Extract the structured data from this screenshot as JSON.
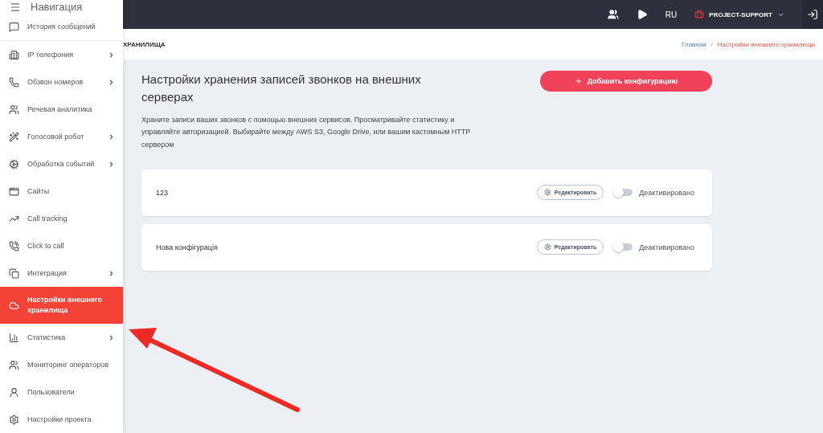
{
  "sidebar": {
    "title": "Навигация",
    "items": [
      {
        "label": "История сообщений",
        "expandable": false,
        "selected": false
      },
      {
        "label": "IP телефония",
        "expandable": true,
        "selected": false
      },
      {
        "label": "Обзвон номеров",
        "expandable": true,
        "selected": false
      },
      {
        "label": "Речевая аналитика",
        "expandable": false,
        "selected": false
      },
      {
        "label": "Голосовой робот",
        "expandable": true,
        "selected": false
      },
      {
        "label": "Обработка событий",
        "expandable": true,
        "selected": false
      },
      {
        "label": "Сайты",
        "expandable": false,
        "selected": false
      },
      {
        "label": "Call tracking",
        "expandable": false,
        "selected": false
      },
      {
        "label": "Click to call",
        "expandable": false,
        "selected": false
      },
      {
        "label": "Интеграция",
        "expandable": true,
        "selected": false
      },
      {
        "label": "Настройки внешнего хранилища",
        "expandable": false,
        "selected": true
      },
      {
        "label": "Статистика",
        "expandable": true,
        "selected": false
      },
      {
        "label": "Мониторинг операторов",
        "expandable": false,
        "selected": false
      },
      {
        "label": "Пользователи",
        "expandable": false,
        "selected": false
      },
      {
        "label": "Настройки проекта",
        "expandable": false,
        "selected": false
      }
    ]
  },
  "topbar": {
    "language": "RU",
    "project": "PROJECT-SUPPORT"
  },
  "page_title": "ХРАНИЛИЩА",
  "breadcrumb_separator": "/",
  "breadcrumbs": [
    {
      "label": "Главная",
      "selected": false
    },
    {
      "label": "Настройки внешнего хранилища",
      "selected": true
    }
  ],
  "content": {
    "title": "Настройки хранения записей звонков на внешних серверах",
    "description": "Храните записи ваших звонков с помощью внешних сервисов. Просматривайте статистику и управляйте авторизацией. Выбирайте между AWS S3, Google Drive, или вашим кастомным HTTP сервером",
    "add_button": "Добавить конфигурацию"
  },
  "configs": [
    {
      "name": "123",
      "edit": "Редактировать",
      "active": false,
      "status": "Деактивировано"
    },
    {
      "name": "Нова конфігурація",
      "edit": "Редактировать",
      "active": false,
      "status": "Деактивировано"
    }
  ]
}
